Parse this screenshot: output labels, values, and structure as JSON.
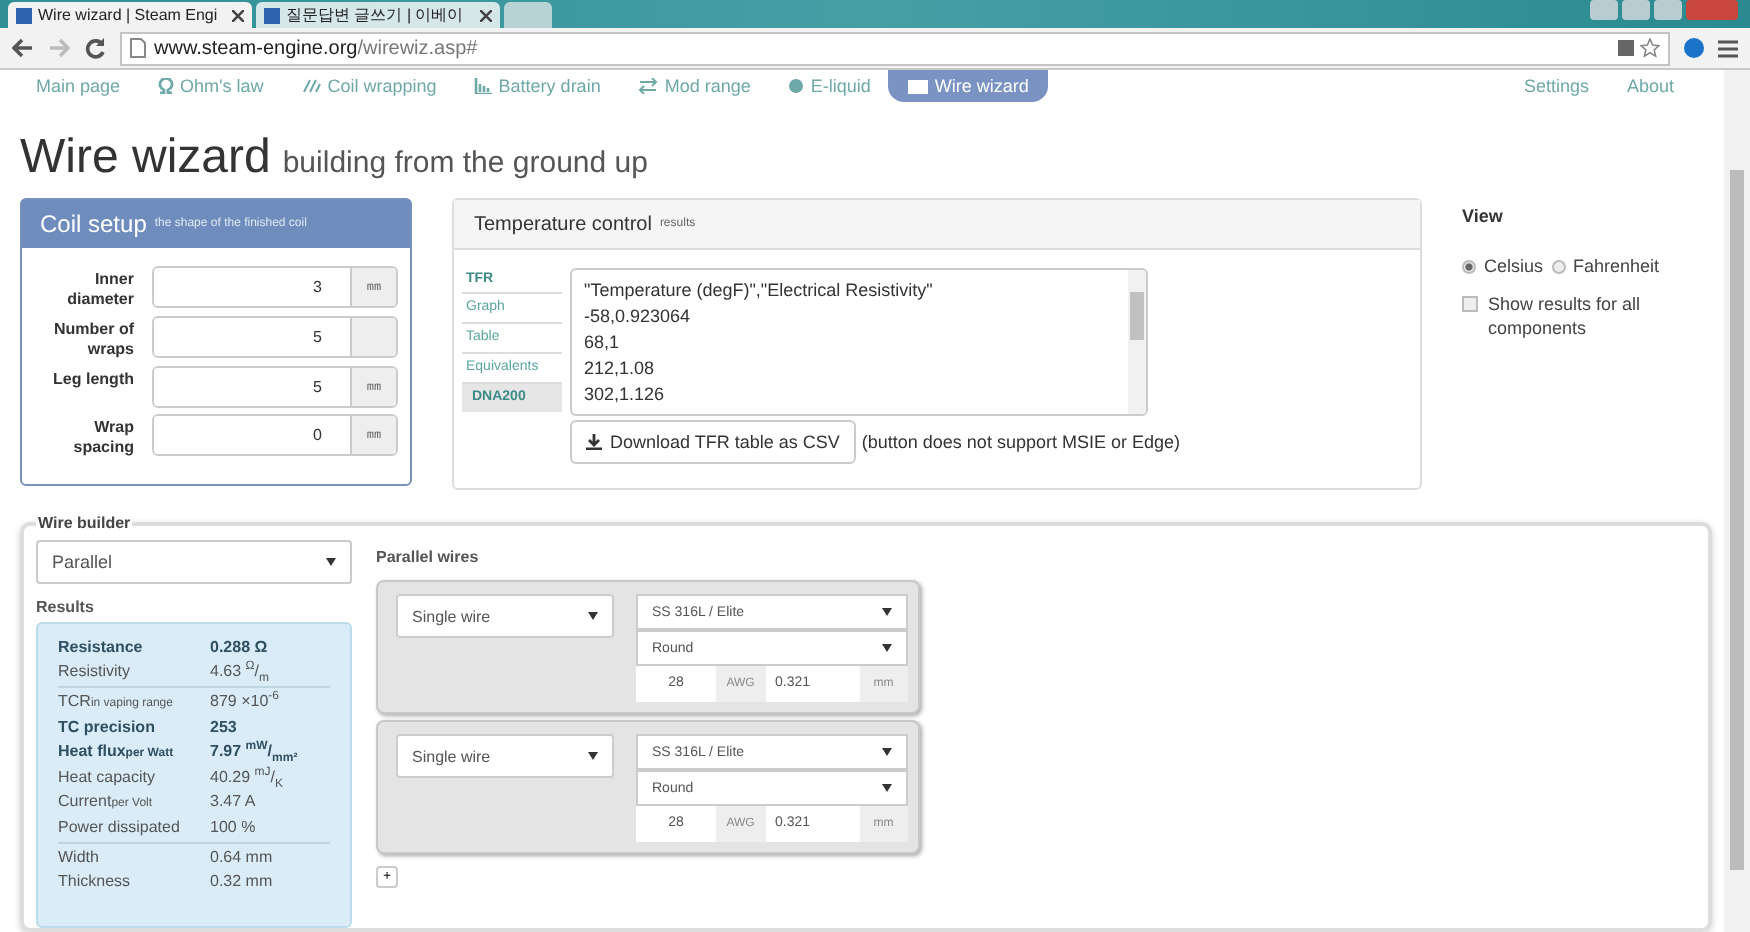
{
  "browser": {
    "tabs": [
      {
        "title": "Wire wizard | Steam Engi",
        "selected": true
      },
      {
        "title": "질문답변 글쓰기 | 이베이",
        "selected": false
      }
    ],
    "url_host": "www.steam-engine.org",
    "url_path": "/wirewiz.asp#"
  },
  "nav": {
    "items": [
      {
        "label": "Main page",
        "selected": false
      },
      {
        "label": "Ohm's law",
        "selected": false
      },
      {
        "label": "Coil wrapping",
        "selected": false
      },
      {
        "label": "Battery drain",
        "selected": false
      },
      {
        "label": "Mod range",
        "selected": false
      },
      {
        "label": "E-liquid",
        "selected": false
      },
      {
        "label": "Wire wizard",
        "selected": true
      }
    ],
    "right": [
      "Settings",
      "About"
    ]
  },
  "title": "Wire wizard",
  "subtitle": "building from the ground up",
  "coil_setup": {
    "title": "Coil setup",
    "subtitle": "the shape of the finished coil",
    "fields": [
      {
        "label": "Inner diameter",
        "value": "3",
        "unit": "mm"
      },
      {
        "label": "Number of wraps",
        "value": "5"
      },
      {
        "label": "Leg length",
        "value": "5",
        "unit": "mm"
      },
      {
        "label": "Wrap spacing",
        "value": "0",
        "unit": "mm"
      }
    ]
  },
  "temperature_control": {
    "title": "Temperature control",
    "subtitle": "results",
    "heading": "TFR",
    "tabs": [
      {
        "label": "Graph",
        "selected": false
      },
      {
        "label": "Table",
        "selected": false
      },
      {
        "label": "Equivalents",
        "selected": false
      },
      {
        "label": "DNA200",
        "selected": true
      }
    ],
    "csv_lines": [
      "\"Temperature (degF)\",\"Electrical Resistivity\"",
      "-58,0.923064",
      "68,1",
      "212,1.08",
      "302,1.126"
    ],
    "download_button": "Download TFR table as CSV",
    "note": "(button does not support MSIE or Edge)"
  },
  "view": {
    "title": "View",
    "units": [
      {
        "label": "Celsius",
        "selected": true
      },
      {
        "label": "Fahrenheit",
        "selected": false
      }
    ],
    "show_all": {
      "label": "Show results for all components",
      "checked": false
    }
  },
  "wire_builder": {
    "legend": "Wire builder",
    "mode": "Parallel",
    "results_title": "Results",
    "results": [
      [
        {
          "label": "Resistance",
          "value": "0.288 Ω",
          "bold": true
        },
        {
          "label": "Resistivity",
          "value": "4.63 $^{Ω}$/$_{m}$",
          "bold": false
        }
      ],
      [
        {
          "label": "TCR",
          "qualifier": "in vaping range",
          "value": "879 ×10$^{-6}$",
          "bold": false
        },
        {
          "label": "TC precision",
          "value": "253",
          "bold": true
        },
        {
          "label": "Heat flux",
          "qualifier": "per Watt",
          "value": "7.97 $^{mW}$/$_{mm²}$",
          "bold": true
        },
        {
          "label": "Heat capacity",
          "value": "40.29 $^{mJ}$/$_{K}$",
          "bold": false
        },
        {
          "label": "Current",
          "qualifier": "per Volt",
          "value": "3.47 A",
          "bold": false
        },
        {
          "label": "Power dissipated",
          "value": "100 %",
          "bold": false
        }
      ],
      [
        {
          "label": "Width",
          "value": "0.64 mm",
          "bold": false
        },
        {
          "label": "Thickness",
          "value": "0.32 mm",
          "bold": false
        }
      ]
    ],
    "wires_title": "Parallel wires",
    "wires": [
      {
        "type": "Single wire",
        "material": "SS 316L / Elite",
        "shape": "Round",
        "gauge": "28",
        "gauge_unit": "AWG",
        "diameter": "0.321",
        "diameter_unit": "mm"
      },
      {
        "type": "Single wire",
        "material": "SS 316L / Elite",
        "shape": "Round",
        "gauge": "28",
        "gauge_unit": "AWG",
        "diameter": "0.321",
        "diameter_unit": "mm"
      }
    ],
    "add_button": "+"
  }
}
